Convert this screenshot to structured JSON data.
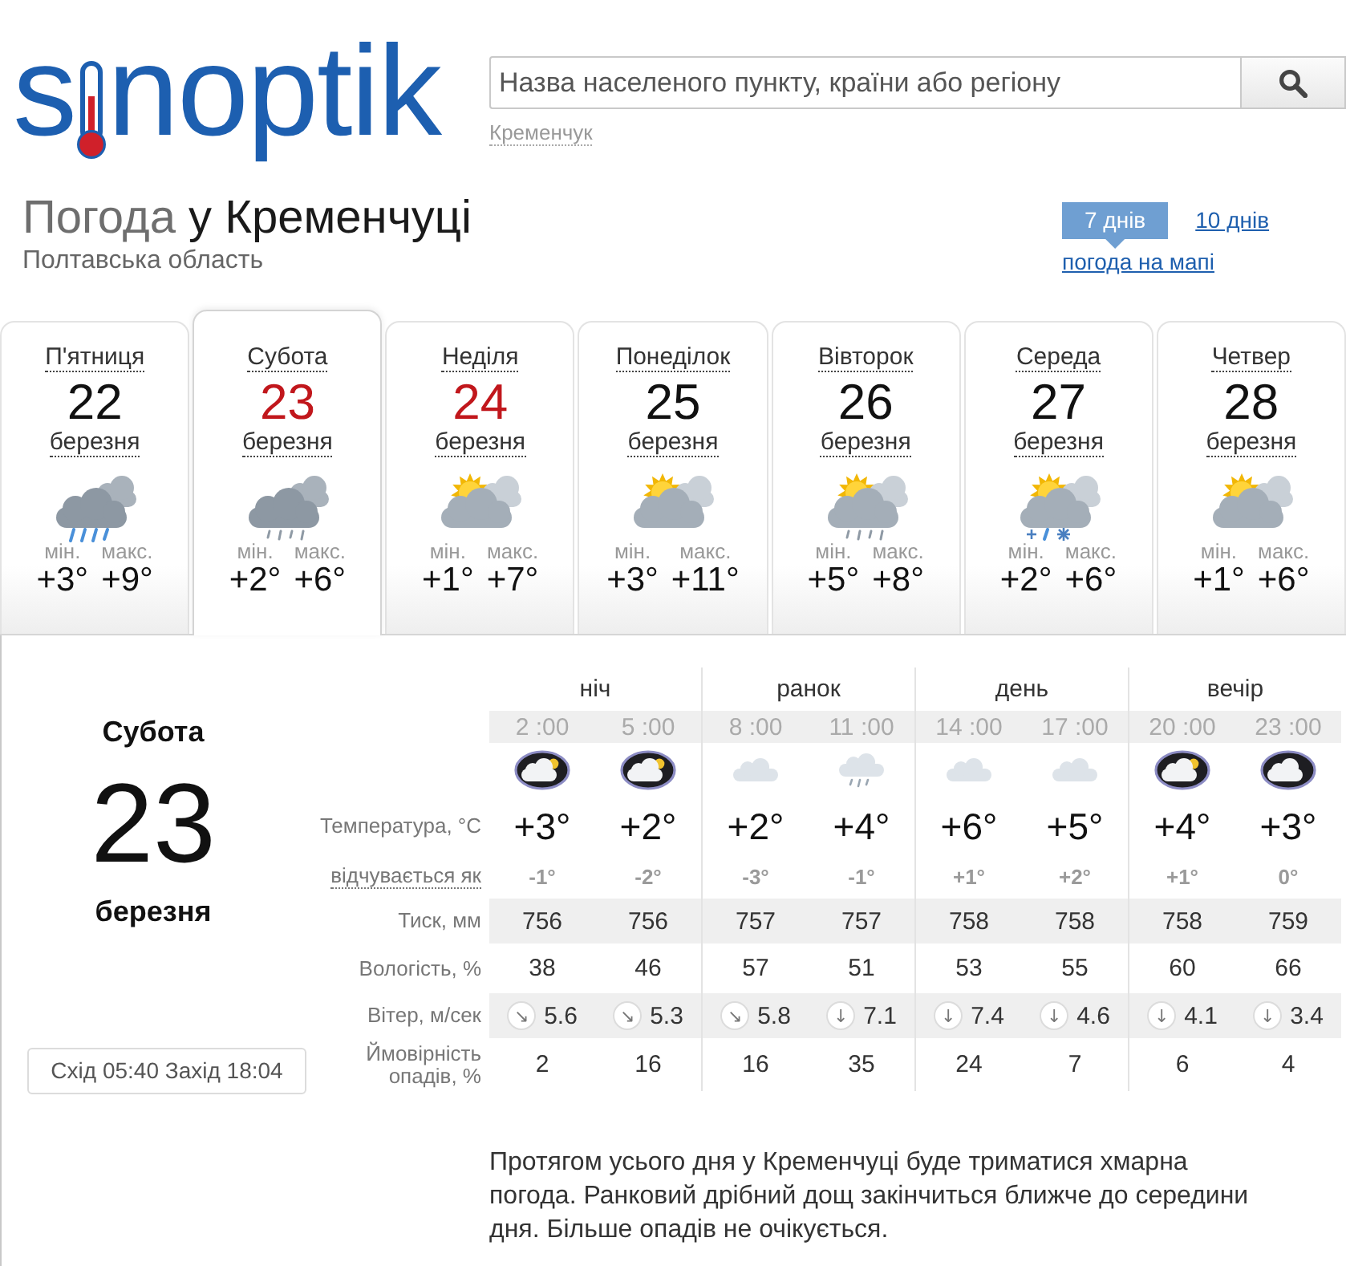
{
  "header": {
    "logo": {
      "before": "s",
      "after": "noptik"
    },
    "search": {
      "placeholder": "Назва населеного пункту, країни або регіону"
    },
    "recent": "Кременчук"
  },
  "title": {
    "lead": "Погода",
    "city": "у Кременчуці",
    "region": "Полтавська область"
  },
  "range_tabs": [
    {
      "label": "7 днів",
      "selected": true
    },
    {
      "label": "10 днів",
      "selected": false
    }
  ],
  "map_link": "погода на мапі",
  "days": [
    {
      "name": "П'ятниця",
      "date": "22",
      "month": "березня",
      "kind": "rain",
      "min_label": "мін.",
      "min": "+3°",
      "max_label": "макс.",
      "max": "+9°",
      "weekend": false,
      "selected": false
    },
    {
      "name": "Субота",
      "date": "23",
      "month": "березня",
      "kind": "drizzle",
      "min_label": "мін.",
      "min": "+2°",
      "max_label": "макс.",
      "max": "+6°",
      "weekend": true,
      "selected": true
    },
    {
      "name": "Неділя",
      "date": "24",
      "month": "березня",
      "kind": "sun-cloud",
      "min_label": "мін.",
      "min": "+1°",
      "max_label": "макс.",
      "max": "+7°",
      "weekend": true,
      "selected": false
    },
    {
      "name": "Понеділок",
      "date": "25",
      "month": "березня",
      "kind": "sun-cloud",
      "min_label": "мін.",
      "min": "+3°",
      "max_label": "макс.",
      "max": "+11°",
      "weekend": false,
      "selected": false
    },
    {
      "name": "Вівторок",
      "date": "26",
      "month": "березня",
      "kind": "sun-cloud-rain",
      "min_label": "мін.",
      "min": "+5°",
      "max_label": "макс.",
      "max": "+8°",
      "weekend": false,
      "selected": false
    },
    {
      "name": "Середа",
      "date": "27",
      "month": "березня",
      "kind": "sun-cloud-sleet",
      "min_label": "мін.",
      "min": "+2°",
      "max_label": "макс.",
      "max": "+6°",
      "weekend": false,
      "selected": false
    },
    {
      "name": "Четвер",
      "date": "28",
      "month": "березня",
      "kind": "sun-cloud",
      "min_label": "мін.",
      "min": "+1°",
      "max_label": "макс.",
      "max": "+6°",
      "weekend": false,
      "selected": false
    }
  ],
  "detail": {
    "day": "Субота",
    "date": "23",
    "month": "березня",
    "sun": "Схід 05:40 Захід 18:04",
    "row_labels": {
      "temperature": "Температура, °C",
      "feels": "відчувається як",
      "pressure": "Тиск, мм",
      "humidity": "Вологість, %",
      "wind": "Вітер, м/сек",
      "precip": "Ймовірність опадів, %"
    },
    "periods": [
      {
        "name": "ніч",
        "hours": [
          {
            "time": "2 :00",
            "kind": "night-cloud",
            "temp": "+3°",
            "feels": "-1°",
            "pressure": "756",
            "humidity": "38",
            "wind_arrow": "↘",
            "wind": "5.6",
            "precip": "2"
          },
          {
            "time": "5 :00",
            "kind": "night-cloud",
            "temp": "+2°",
            "feels": "-2°",
            "pressure": "756",
            "humidity": "46",
            "wind_arrow": "↘",
            "wind": "5.3",
            "precip": "16"
          }
        ]
      },
      {
        "name": "ранок",
        "hours": [
          {
            "time": "8 :00",
            "kind": "cloud",
            "temp": "+2°",
            "feels": "-3°",
            "pressure": "757",
            "humidity": "57",
            "wind_arrow": "↘",
            "wind": "5.8",
            "precip": "16"
          },
          {
            "time": "11 :00",
            "kind": "cloud-drizzle",
            "temp": "+4°",
            "feels": "-1°",
            "pressure": "757",
            "humidity": "51",
            "wind_arrow": "↓",
            "wind": "7.1",
            "precip": "35"
          }
        ]
      },
      {
        "name": "день",
        "hours": [
          {
            "time": "14 :00",
            "kind": "cloud",
            "temp": "+6°",
            "feels": "+1°",
            "pressure": "758",
            "humidity": "53",
            "wind_arrow": "↓",
            "wind": "7.4",
            "precip": "24"
          },
          {
            "time": "17 :00",
            "kind": "cloud",
            "temp": "+5°",
            "feels": "+2°",
            "pressure": "758",
            "humidity": "55",
            "wind_arrow": "↓",
            "wind": "4.6",
            "precip": "7"
          }
        ]
      },
      {
        "name": "вечір",
        "hours": [
          {
            "time": "20 :00",
            "kind": "night-cloud",
            "temp": "+4°",
            "feels": "+1°",
            "pressure": "758",
            "humidity": "60",
            "wind_arrow": "↓",
            "wind": "4.1",
            "precip": "6"
          },
          {
            "time": "23 :00",
            "kind": "night-overcast",
            "temp": "+3°",
            "feels": "0°",
            "pressure": "759",
            "humidity": "66",
            "wind_arrow": "↓",
            "wind": "3.4",
            "precip": "4"
          }
        ]
      }
    ],
    "description": "Протягом усього дня у Кременчуці буде триматися хмарна погода. Ранковий дрібний дощ закінчиться ближче до середини дня. Більше опадів не очікується."
  }
}
